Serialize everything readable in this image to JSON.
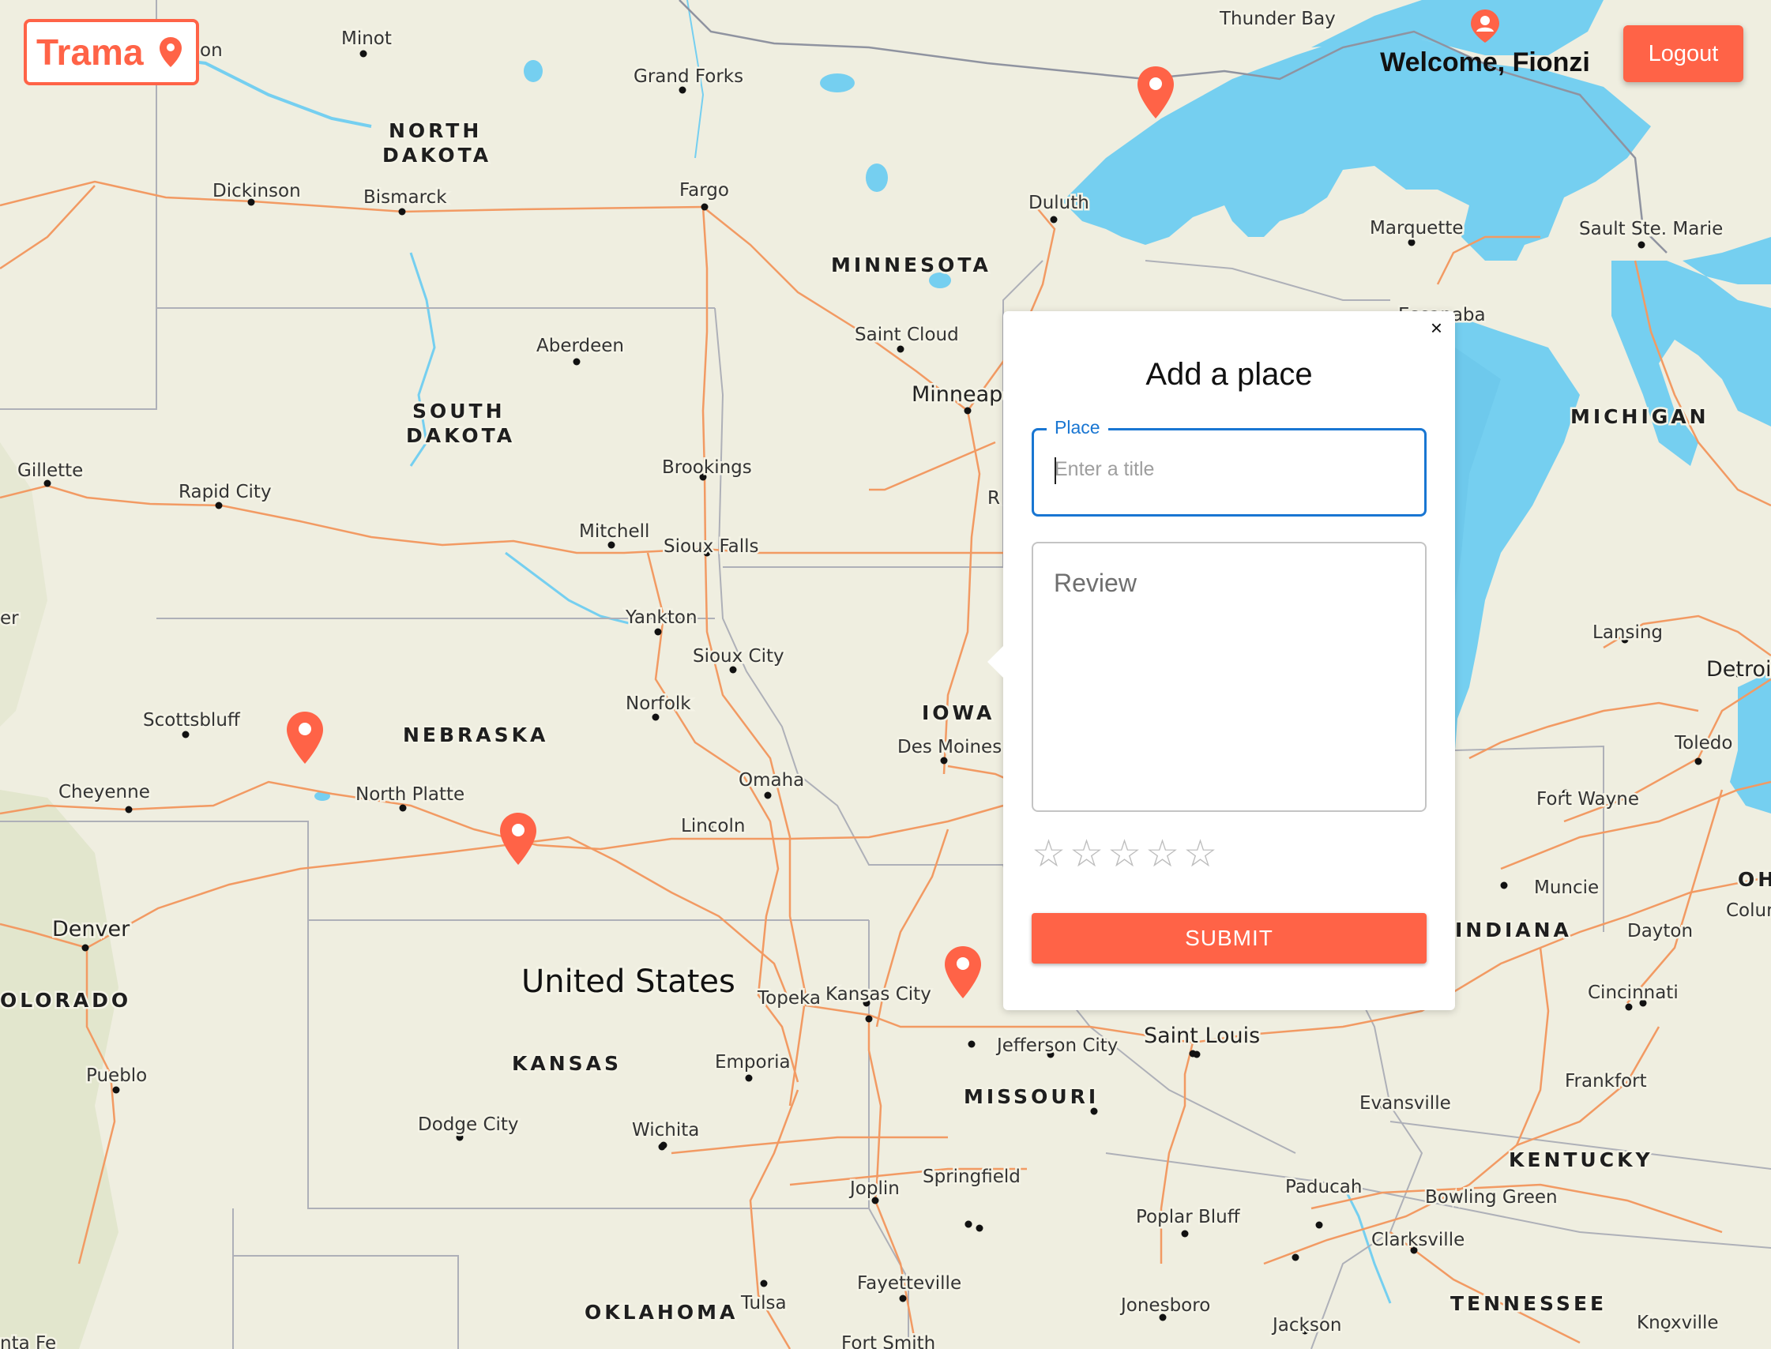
{
  "header": {
    "logo_text": "Trama",
    "welcome_text": "Welcome, Fionzi",
    "logout_label": "Logout",
    "accent_color": "#ff6347"
  },
  "popup": {
    "close_label": "×",
    "title": "Add a place",
    "place_label": "Place",
    "place_placeholder": "Enter a title",
    "place_value": "",
    "review_placeholder": "Review",
    "rating": 0,
    "rating_max": 5,
    "star_glyph": "☆",
    "submit_label": "SUBMIT"
  },
  "map": {
    "water_color": "#75cff0",
    "land_color": "#efeee0",
    "road_color": "#f29a63",
    "marker_count": 5,
    "country_label": "United States",
    "states": [
      "NORTH",
      "DAKOTA",
      "SOUTH",
      "DAKOTA",
      "MINNESOTA",
      "NEBRASKA",
      "IOWA",
      "KANSAS",
      "MISSOURI",
      "MICHIGAN",
      "INDIANA",
      "KENTUCKY",
      "TENNESSEE",
      "OKLAHOMA",
      "OLORADO",
      "OH"
    ],
    "cities": [
      "Minot",
      "on",
      "Grand Forks",
      "Thunder Bay",
      "Dickinson",
      "Bismarck",
      "Fargo",
      "Duluth",
      "Marquette",
      "Sault Ste. Marie",
      "Aberdeen",
      "Saint Cloud",
      "Minneapo",
      "Escanaba",
      "Gillette",
      "Rapid City",
      "Brookings",
      "R",
      "Mitchell",
      "Sioux Falls",
      "Yankton",
      "Sioux City",
      "Lansing",
      "Detroit",
      "er",
      "Scottsbluff",
      "Norfolk",
      "Des Moines",
      "Toledo",
      "Cheyenne",
      "North Platte",
      "Omaha",
      "Fort Wayne",
      "Lincoln",
      "Muncie",
      "Columbu",
      "Denver",
      "Dayton",
      "Topeka",
      "Kansas City",
      "Cincinnati",
      "Jefferson City",
      "Saint Louis",
      "Emporia",
      "Pueblo",
      "Evansville",
      "Frankfort",
      "Dodge City",
      "Wichita",
      "Springfield",
      "Joplin",
      "Paducah",
      "Bowling Green",
      "Poplar Bluff",
      "Clarksville",
      "Fayetteville",
      "Tulsa",
      "Jonesboro",
      "Jackson",
      "Knoxville",
      "Fort Smith",
      "nta Fe"
    ]
  }
}
